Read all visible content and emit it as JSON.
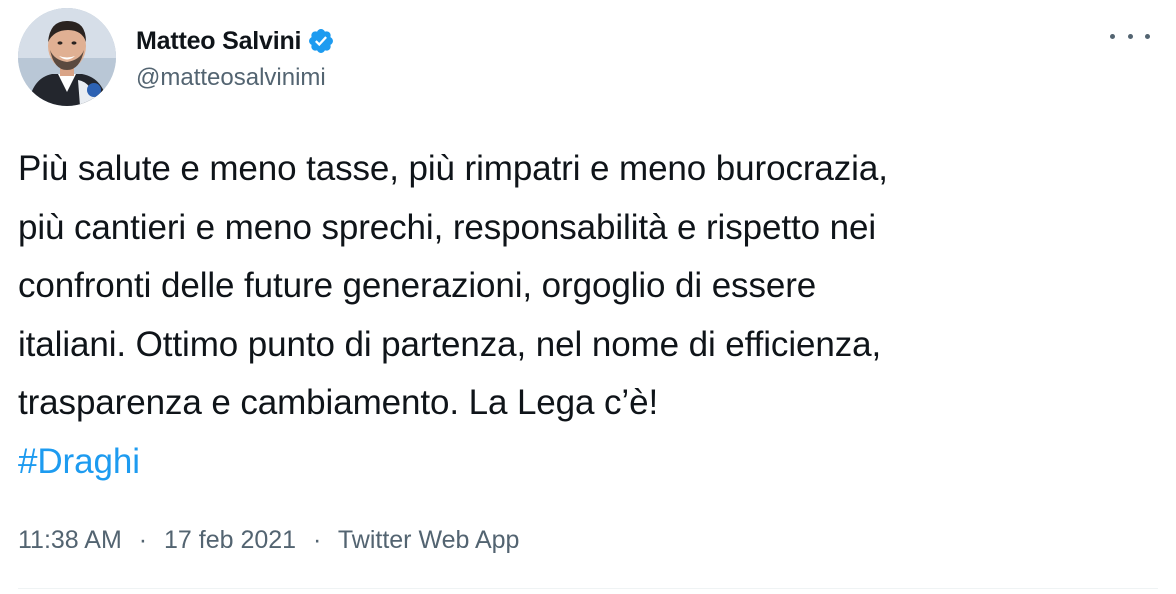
{
  "author": {
    "display_name": "Matteo Salvini",
    "handle": "@matteosalvinimi",
    "verified_icon": "verified-badge-icon"
  },
  "more_icon": "more-horizontal-icon",
  "tweet": {
    "lines": [
      "Più salute e meno tasse, più rimpatri e meno burocrazia,",
      "più cantieri e meno sprechi, responsabilità e rispetto nei",
      "confronti delle future generazioni, orgoglio di essere",
      "italiani. Ottimo punto di partenza, nel nome di efficienza,",
      "trasparenza e cambiamento. La Lega c’è!"
    ],
    "hashtag": "#Draghi"
  },
  "meta": {
    "time": "11:38 AM",
    "separator": "·",
    "date": "17 feb 2021",
    "source": "Twitter Web App"
  },
  "colors": {
    "accent": "#1d9bf0",
    "text_primary": "#0f1419",
    "text_secondary": "#536471"
  }
}
